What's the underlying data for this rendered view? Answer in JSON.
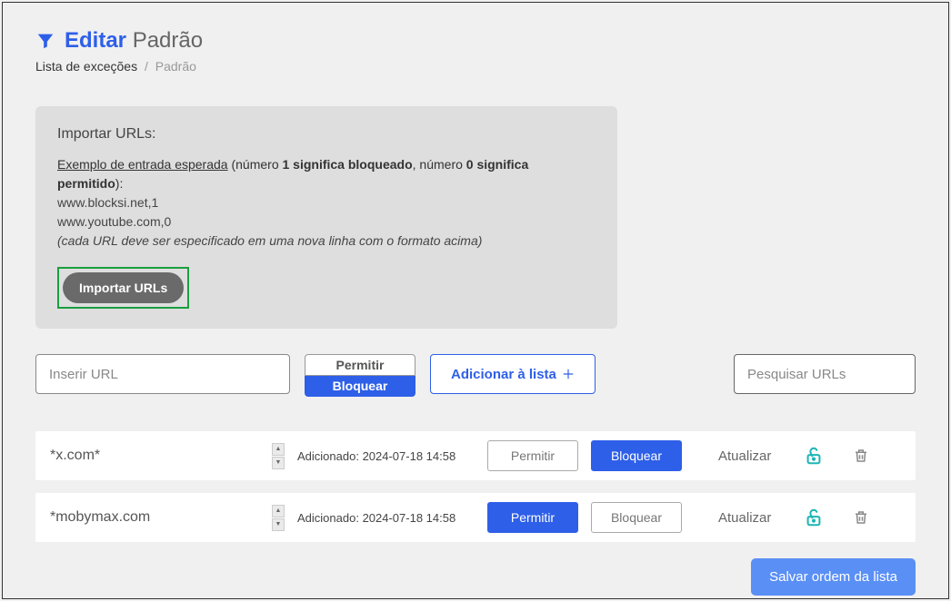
{
  "header": {
    "title_strong": "Editar",
    "title_light": "Padrão"
  },
  "breadcrumb": {
    "root": "Lista de exceções",
    "current": "Padrão"
  },
  "import_panel": {
    "heading": "Importar URLs:",
    "example_link": "Exemplo de entrada esperada",
    "desc_part1": " (número ",
    "desc_bold1": "1 significa bloqueado",
    "desc_part2": ", número ",
    "desc_bold2": "0 significa permitido",
    "desc_part3": "):",
    "line1": "www.blocksi.net,1",
    "line2": "www.youtube.com,0",
    "note": "(cada URL deve ser especificado em uma nova linha com o formato acima)",
    "button": "Importar URLs"
  },
  "controls": {
    "url_placeholder": "Inserir URL",
    "permit": "Permitir",
    "block": "Bloquear",
    "add_label": "Adicionar à lista",
    "search_placeholder": "Pesquisar URLs"
  },
  "rows": [
    {
      "url": "*x.com*",
      "added_prefix": "Adicionado: ",
      "added_ts": "2024-07-18 14:58",
      "permit_active": false,
      "block_active": true,
      "update": "Atualizar"
    },
    {
      "url": "*mobymax.com",
      "added_prefix": "Adicionado: ",
      "added_ts": "2024-07-18 14:58",
      "permit_active": true,
      "block_active": false,
      "update": "Atualizar"
    }
  ],
  "save_button": "Salvar ordem da lista"
}
